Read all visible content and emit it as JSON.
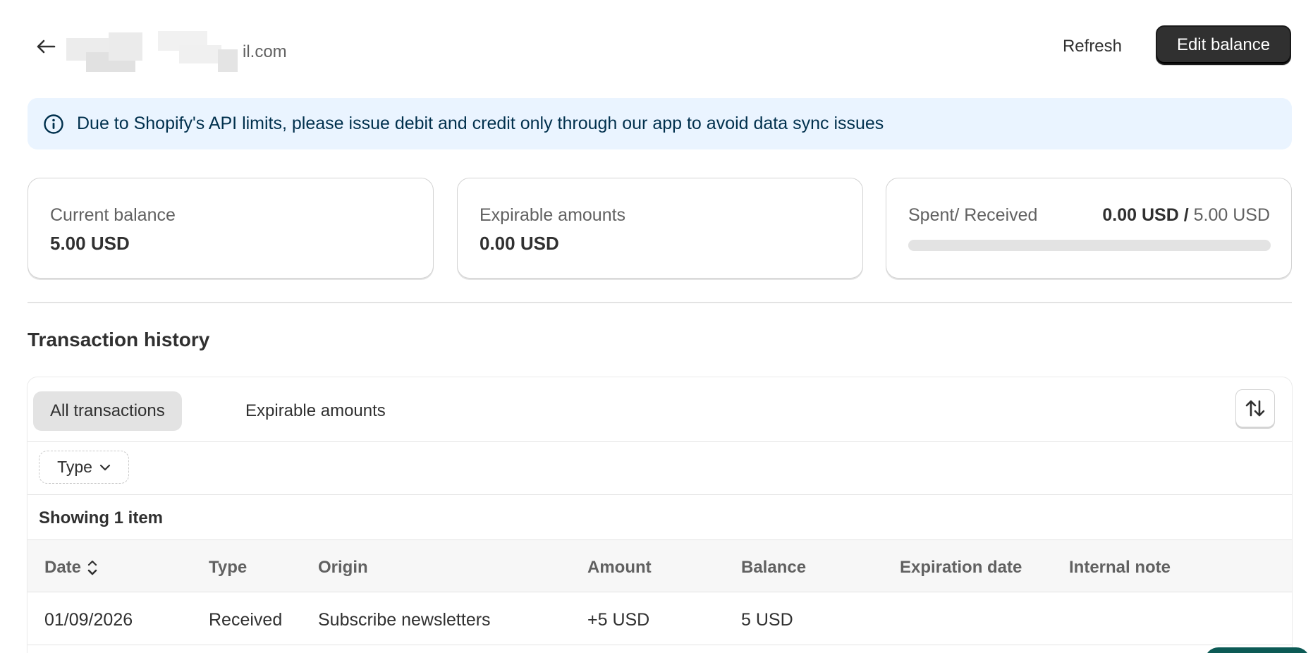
{
  "header": {
    "email_suffix": "il.com",
    "refresh_label": "Refresh",
    "edit_balance_label": "Edit balance"
  },
  "banner": {
    "text": "Due to Shopify's API limits, please issue debit and credit only through our app to avoid data sync issues",
    "icon": "info-icon",
    "color": "#eaf4ff"
  },
  "cards": {
    "current_balance": {
      "label": "Current balance",
      "value": "5.00 USD"
    },
    "expirable": {
      "label": "Expirable amounts",
      "value": "0.00 USD"
    },
    "spent_received": {
      "label": "Spent/ Received",
      "spent": "0.00 USD",
      "separator": " / ",
      "received": "5.00 USD",
      "progress_fraction": 0
    }
  },
  "transactions": {
    "title": "Transaction history",
    "tabs": [
      {
        "label": "All transactions",
        "active": true
      },
      {
        "label": "Expirable amounts",
        "active": false
      }
    ],
    "filter_label": "Type",
    "count_text": "Showing 1 item",
    "columns": [
      "Date",
      "Type",
      "Origin",
      "Amount",
      "Balance",
      "Expiration date",
      "Internal note"
    ],
    "rows": [
      {
        "date": "01/09/2026",
        "type": "Received",
        "origin": "Subscribe newsletters",
        "amount": "+5 USD",
        "balance": "5 USD",
        "expiration": "",
        "note": ""
      }
    ]
  },
  "colors": {
    "primary_button": "#303030",
    "chat_bubble": "#0c5a55"
  }
}
